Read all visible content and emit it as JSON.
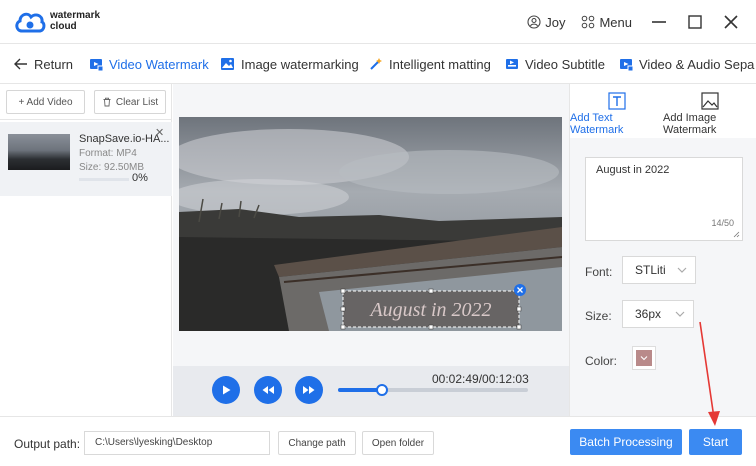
{
  "app": {
    "logo_line1": "watermark",
    "logo_line2": "cloud",
    "user_name": "Joy",
    "menu_label": "Menu"
  },
  "tabs": [
    {
      "label": "Return",
      "icon": "arrow-left-icon",
      "active": false
    },
    {
      "label": "Video Watermark",
      "icon": "video-watermark-icon",
      "active": true
    },
    {
      "label": "Image watermarking",
      "icon": "image-icon",
      "active": false
    },
    {
      "label": "Intelligent matting",
      "icon": "magic-wand-icon",
      "active": false
    },
    {
      "label": "Video Subtitle",
      "icon": "video-subtitle-icon",
      "active": false
    },
    {
      "label": "Video & Audio Sepa",
      "icon": "video-audio-icon",
      "active": false
    }
  ],
  "left_panel": {
    "add_video": "+ Add Video",
    "clear_list": "Clear List",
    "file": {
      "name": "SnapSave.io-HA...",
      "format": "Format:  MP4",
      "size": "Size:  92.50MB",
      "progress_label": "0%",
      "progress": 0
    }
  },
  "video": {
    "watermark_text": "August in 2022"
  },
  "player": {
    "timecode": "00:02:49/00:12:03",
    "position_fraction": 0.23
  },
  "right_panel": {
    "tab_text": "Add Text Watermark",
    "tab_image": "Add Image Watermark",
    "text_value": "August in 2022",
    "char_count": "14/50",
    "font_label": "Font:",
    "font_value": "STLiti",
    "size_label": "Size:",
    "size_value": "36px",
    "color_label": "Color:",
    "color_value": "#b98a8a"
  },
  "bottom": {
    "output_label": "Output path:",
    "output_path": "C:\\Users\\lyesking\\Desktop",
    "change_path": "Change path",
    "open_folder": "Open folder",
    "batch_processing": "Batch Processing",
    "start": "Start"
  },
  "colors": {
    "accent": "#1f6fe8",
    "primary_button": "#3b8af2",
    "annotation_arrow": "#e53935"
  }
}
